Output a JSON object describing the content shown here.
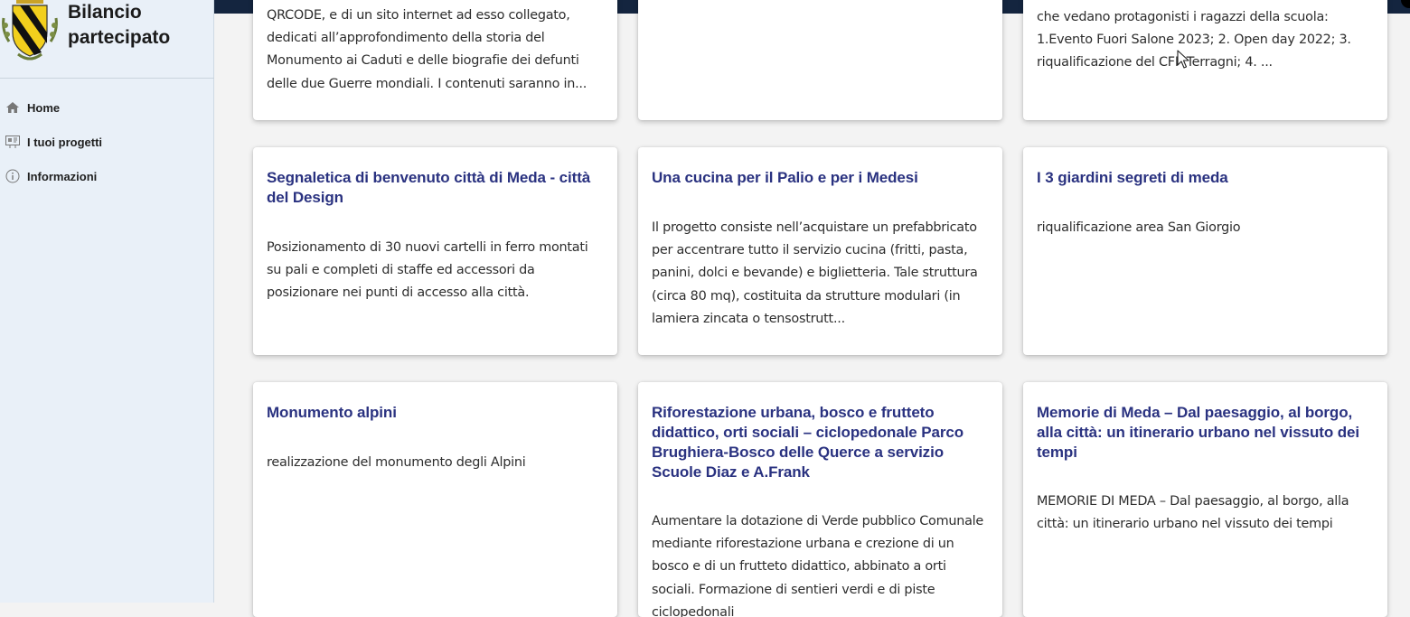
{
  "sidebar": {
    "title": "Bilancio partecipato",
    "nav": [
      {
        "label": "Home",
        "icon": "home-icon"
      },
      {
        "label": "I tuoi progetti",
        "icon": "projects-icon"
      },
      {
        "label": "Informazioni",
        "icon": "info-icon"
      }
    ]
  },
  "cards": [
    {
      "title": "",
      "description": "QRCODE, e di un sito internet ad esso collegato, dedicati all’approfondimento della storia del Monumento ai Caduti e delle biografie dei defunti delle due Guerre mondiali. I contenuti saranno in..."
    },
    {
      "title": "",
      "description": ""
    },
    {
      "title": "",
      "description": "che vedano protagonisti i ragazzi della scuola: 1.Evento Fuori Salone 2023; 2. Open day 2022; 3. riqualificazione del CFP Terragni; 4. ..."
    },
    {
      "title": "Segnaletica di benvenuto città di Meda - città del Design",
      "description": "Posizionamento di 30 nuovi cartelli in ferro montati su pali e completi di staffe ed accessori da posizionare nei punti di accesso alla città."
    },
    {
      "title": "Una cucina per il Palio e per i Medesi",
      "description": "Il progetto consiste nell’acquistare un prefabbricato per accentrare tutto il servizio cucina (fritti, pasta, panini, dolci e bevande) e biglietteria. Tale struttura (circa 80 mq), costituita da strutture modulari (in lamiera zincata o tensostrutt..."
    },
    {
      "title": "I 3 giardini segreti di meda",
      "description": "riqualificazione area San Giorgio"
    },
    {
      "title": "Monumento alpini",
      "description": "realizzazione del monumento degli Alpini"
    },
    {
      "title": "Riforestazione urbana, bosco e frutteto didattico, orti sociali – ciclopedonale Parco Brughiera-Bosco delle Querce a servizio Scuole Diaz e A.Frank",
      "description": "Aumentare la dotazione di Verde pubblico Comunale mediante riforestazione urbana e crezione di un bosco e di un frutteto didattico, abbinato a orti sociali. Formazione di sentieri verdi e di piste ciclopedonali"
    },
    {
      "title": "Memorie di Meda – Dal paesaggio, al borgo, alla città: un itinerario urbano nel vissuto dei tempi",
      "description": "MEMORIE DI MEDA – Dal paesaggio, al borgo, alla città: un itinerario urbano nel vissuto dei tempi"
    }
  ],
  "colors": {
    "accent": "#2a3280",
    "topbar": "#14253f",
    "sidebar": "#e9f0f8"
  }
}
